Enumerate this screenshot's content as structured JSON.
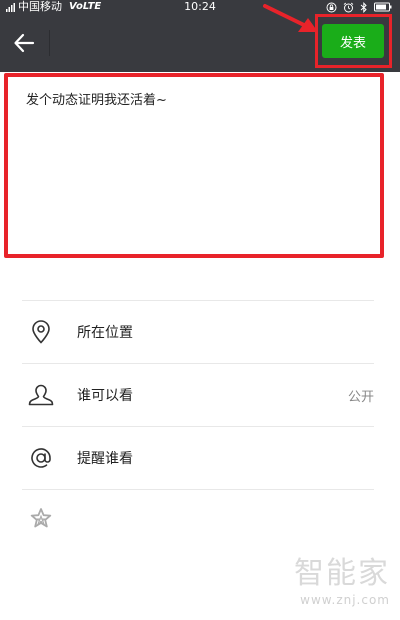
{
  "status_bar": {
    "carrier": "中国移动",
    "network": "VoLTE",
    "time": "10:24",
    "icons": [
      "lock-rotation-icon",
      "alarm-icon",
      "bluetooth-icon",
      "battery-icon"
    ]
  },
  "top_bar": {
    "back_icon": "arrow-left-icon",
    "publish_label": "发表",
    "publish_color": "#1aad19",
    "bar_color": "#393a3f"
  },
  "annotation": {
    "highlight_color": "#e8232a"
  },
  "post": {
    "text": "发个动态证明我还活着~"
  },
  "options": [
    {
      "icon": "location-pin-icon",
      "label": "所在位置",
      "value": ""
    },
    {
      "icon": "person-icon",
      "label": "谁可以看",
      "value": "公开"
    },
    {
      "icon": "at-sign-icon",
      "label": "提醒谁看",
      "value": ""
    }
  ],
  "extra": {
    "icon": "star-icon"
  },
  "watermark": {
    "logo": "智能家",
    "url": "www.znj.com"
  }
}
